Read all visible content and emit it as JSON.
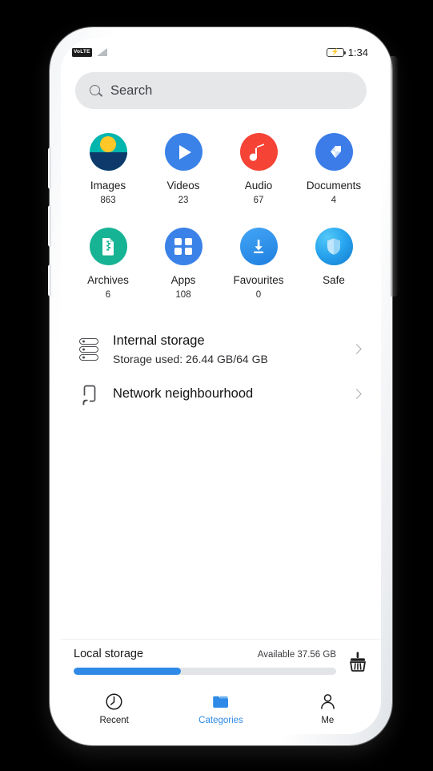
{
  "status_bar": {
    "network_badge": "VoLTE",
    "signal_icon": "signal-bars-icon",
    "battery_icon": "battery-charging-icon",
    "time": "1:34"
  },
  "search": {
    "icon": "search-icon",
    "placeholder": "Search"
  },
  "categories": {
    "rows": [
      [
        {
          "label": "Images",
          "count": "863",
          "icon": "images-icon",
          "accent": "#00b5ad"
        },
        {
          "label": "Videos",
          "count": "23",
          "icon": "video-play-icon",
          "accent": "#3b82e8"
        },
        {
          "label": "Audio",
          "count": "67",
          "icon": "music-note-icon",
          "accent": "#f54336"
        },
        {
          "label": "Documents",
          "count": "4",
          "icon": "document-icon",
          "accent": "#3b7ce8"
        }
      ],
      [
        {
          "label": "Archives",
          "count": "6",
          "icon": "zip-file-icon",
          "accent": "#16b394"
        },
        {
          "label": "Apps",
          "count": "108",
          "icon": "apps-grid-icon",
          "accent": "#3b82e8"
        },
        {
          "label": "Favourites",
          "count": "0",
          "icon": "download-icon",
          "accent": "#2e8ae6"
        },
        {
          "label": "Safe",
          "count": "",
          "icon": "shield-icon",
          "accent": "#29a6ef"
        }
      ]
    ]
  },
  "storage_rows": [
    {
      "title": "Internal storage",
      "subtitle": "Storage used: 26.44 GB/64 GB",
      "icon": "disk-stack-icon"
    },
    {
      "title": "Network neighbourhood",
      "subtitle": "",
      "icon": "network-device-icon"
    }
  ],
  "local_storage": {
    "label": "Local storage",
    "available": "Available 37.56 GB",
    "fill_percent": 41,
    "bar_color": "#2e8ae6",
    "clean_icon": "broom-clean-icon"
  },
  "bottom_nav": {
    "active_color": "#2e8ae6",
    "items": [
      {
        "label": "Recent",
        "icon": "clock-icon",
        "active": false
      },
      {
        "label": "Categories",
        "icon": "folder-icon",
        "active": true
      },
      {
        "label": "Me",
        "icon": "person-icon",
        "active": false
      }
    ]
  }
}
